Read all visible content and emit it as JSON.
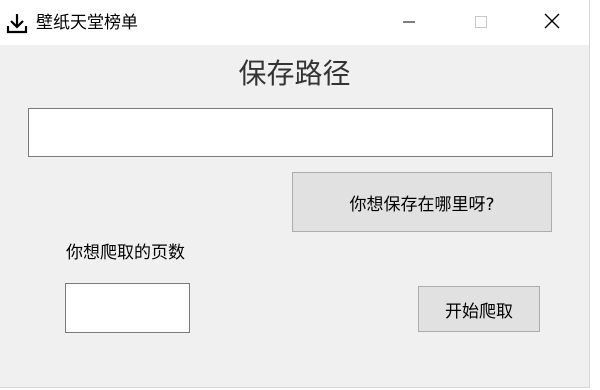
{
  "window": {
    "title": "壁纸天堂榜单",
    "icon": "download-icon"
  },
  "titlebar_controls": {
    "minimize_icon": "minimize-icon",
    "maximize_icon": "maximize-icon",
    "close_icon": "close-icon"
  },
  "form": {
    "heading": "保存路径",
    "path_value": "",
    "path_placeholder": "",
    "choose_button_label": "你想保存在哪里呀?",
    "pages_label": "你想爬取的页数",
    "pages_value": "",
    "start_button_label": "开始爬取"
  },
  "colors": {
    "window_background": "#f0f0f0",
    "titlebar_background": "#ffffff",
    "button_background": "#e1e1e1",
    "button_border": "#adadad"
  }
}
